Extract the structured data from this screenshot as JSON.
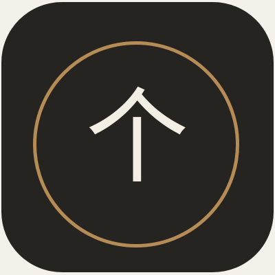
{
  "icon": {
    "glyph": "个",
    "colors": {
      "outer_background": "#f4f1ea",
      "tile_background": "#262420",
      "ring": "#b58b56",
      "glyph": "#f4efe4"
    }
  }
}
